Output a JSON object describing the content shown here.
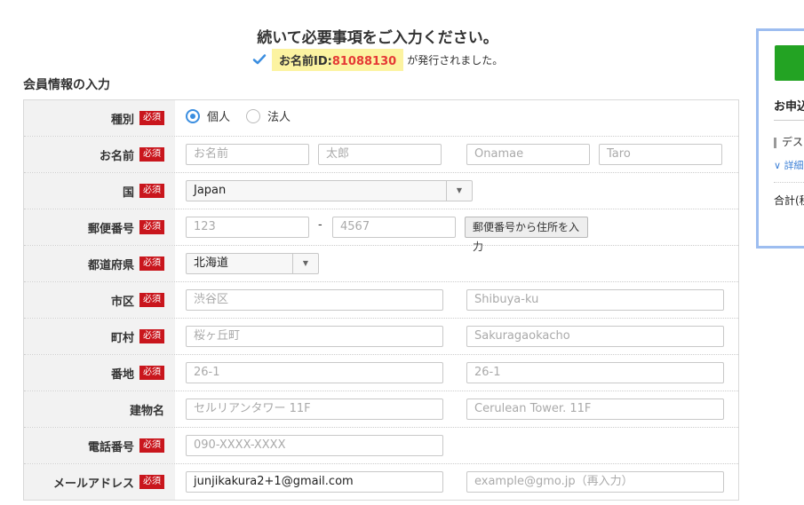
{
  "header": {
    "heading": "続いて必要事項をご入力ください。",
    "id_label": "お名前ID:",
    "id_value": "81088130",
    "id_suffix": "が発行されました。"
  },
  "section_title": "会員情報の入力",
  "required_badge": "必須",
  "rows": {
    "type": {
      "label": "種別",
      "options": [
        "個人",
        "法人"
      ],
      "selected": "個人"
    },
    "name": {
      "label": "お名前",
      "placeholders": [
        "お名前",
        "太郎",
        "Onamae",
        "Taro"
      ]
    },
    "country": {
      "label": "国",
      "value": "Japan"
    },
    "postal": {
      "label": "郵便番号",
      "placeholders": [
        "123",
        "4567"
      ],
      "separator": "-",
      "button": "郵便番号から住所を入力"
    },
    "prefecture": {
      "label": "都道府県",
      "value": "北海道"
    },
    "city": {
      "label": "市区",
      "placeholders": [
        "渋谷区",
        "Shibuya-ku"
      ]
    },
    "town": {
      "label": "町村",
      "placeholders": [
        "桜ヶ丘町",
        "Sakuragaokacho"
      ]
    },
    "block": {
      "label": "番地",
      "placeholders": [
        "26-1",
        "26-1"
      ]
    },
    "building": {
      "label": "建物名",
      "placeholders": [
        "セルリアンタワー 11F",
        "Cerulean Tower. 11F"
      ]
    },
    "phone": {
      "label": "電話番号",
      "placeholder": "090-XXXX-XXXX"
    },
    "email": {
      "label": "メールアドレス",
      "value": "junjikakura2+1@gmail.com",
      "confirm_placeholder": "example@gmo.jp（再入力）"
    }
  },
  "side_panel": {
    "title": "お申込",
    "item": "デス",
    "detail": "詳細",
    "total": "合計(税"
  },
  "colors": {
    "required": "#c9161d",
    "id_highlight": "#fcf3a1",
    "id_number": "#e53935",
    "radio_active": "#3b8ee0",
    "panel_border": "#9dbdf0",
    "cta_green": "#23a323"
  }
}
